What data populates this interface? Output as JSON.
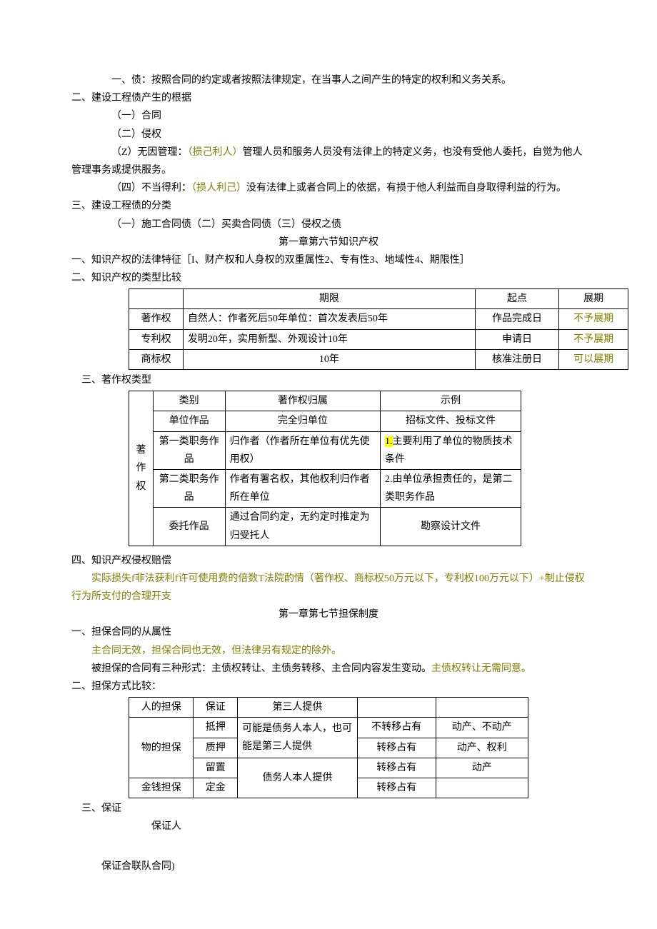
{
  "p1": "一、债：按照合同的约定或者按照法律规定，在当事人之间产生的特定的权利和义务关系。",
  "p2": "二、建设工程债产生的根据",
  "p3": "（一）合同",
  "p4": "（二）侵权",
  "p5a": "（Z）无因管理：",
  "p5b": "（损己利人）",
  "p5c": "管理人员和服务人员没有法律上的特定义务，也没有受他人委托，自觉为他人管理事务或提供服务。",
  "p6a": "（四）不当得利：",
  "p6b": "（损人利己）",
  "p6c": "没有法律上或者合同上的依据，有损于他人利益而自身取得利益的行为。",
  "p7": "三、建设工程债的分类",
  "p8": "（一）施工合同债（二）买卖合同债（三）侵权之债",
  "s6": "第一章第六节知识产权",
  "p9": "一、知识产权的法律特征［I、财产权和人身权的双重属性2、专有性3、地域性4、期限性］",
  "p10": "二、知识产权的类型比较",
  "t1": {
    "h1": "",
    "h2": "期限",
    "h3": "起点",
    "h4": "展期",
    "r1c1": "著作权",
    "r1c2": "自然人：作者死后50年单位：首次发表后50年",
    "r1c3": "作品完成日",
    "r1c4": "不予展期",
    "r2c1": "专利权",
    "r2c2": "发明20年，实用新型、外观设计10年",
    "r2c3": "申请日",
    "r2c4": "不予展期",
    "r3c1": "商标权",
    "r3c2": "10年",
    "r3c3": "核准注册日",
    "r3c4": "可以展期"
  },
  "p11": "三、著作权类型",
  "t2": {
    "head_a": "",
    "head_b": "类别",
    "head_c": "著作权归属",
    "head_d": "示例",
    "side": "著作权",
    "r1b": "单位作品",
    "r1c": "完全归单位",
    "r1d": "招标文件、投标文件",
    "r2b": "第一类职务作品",
    "r2c": "归作者（作者所在单位有优先使用权）",
    "r2d_pre": "",
    "r2d_hl": "1.",
    "r2d_post": "主要利用了单位的物质技术条件",
    "r3b": "第二类职务作品",
    "r3c": "作者有署名权，其他权利归作者所在单位",
    "r3d": "2.由单位承担责任的，是第二类职务作品",
    "r4b": "委托作品",
    "r4c": "通过合同约定，无约定时推定为归受托人",
    "r4d": "勘察设计文件"
  },
  "p12": "四、知识产权侵权赔偿",
  "p13": "实际损失f非法获利f许可使用费的倍数T法院酌情（著作权、商标权50万元以下，专利权100万元以下）+制止侵权行为所支付的合理开支",
  "s7": "第一章第七节担保制度",
  "p14": "一、担保合同的从属性",
  "p15": "主合同无效，担保合同也无效，但法律另有规定的除外。",
  "p16a": "被担保的合同有三种形式：主债权转让、主债务转移、主合同内容发生变动。",
  "p16b": "主债权转让无需同意。",
  "p17": "二、担保方式比较：",
  "t3": {
    "r1c1": "人的担保",
    "r1c2": "保证",
    "r1c3": "第三人提供",
    "r1c4": "",
    "r1c5": "",
    "r2c1": "物的担保",
    "r2c2": "抵押",
    "r2c3": "可能是债务人本人，也可能是第三人提供",
    "r2c4": "不转移占有",
    "r2c5": "动产、不动产",
    "r3c2": "质押",
    "r3c4": "转移占有",
    "r3c5": "动产、权利",
    "r4c2": "留置",
    "r4c3": "债务人本人提供",
    "r4c4": "转移占有",
    "r4c5": "动产",
    "r5c1": "金钱担保",
    "r5c2": "定金",
    "r5c4": "转移占有",
    "r5c5": ""
  },
  "p18": "三、保证",
  "p19": "保证人",
  "p20": "保证合联队合同)"
}
